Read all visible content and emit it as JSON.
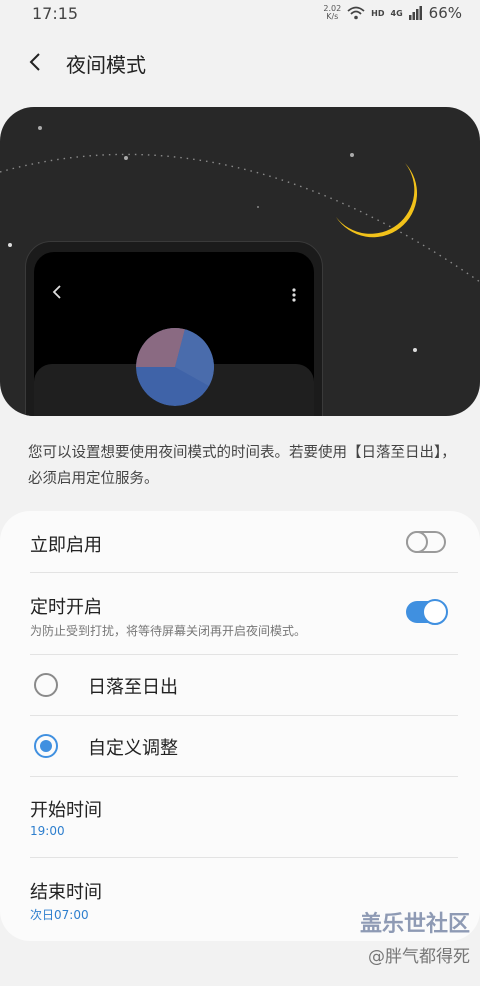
{
  "status": {
    "time": "17:15",
    "net_speed_top": "2.02",
    "net_speed_unit": "K/s",
    "hd": "HD",
    "network": "4G",
    "battery": "66%"
  },
  "header": {
    "title": "夜间模式"
  },
  "description": "您可以设置想要使用夜间模式的时间表。若要使用【日落至日出】，必须启用定位服务。",
  "settings": {
    "instant": {
      "label": "立即启用",
      "enabled": false
    },
    "scheduled": {
      "label": "定时开启",
      "sub": "为防止受到打扰，将等待屏幕关闭再开启夜间模式。",
      "enabled": true
    },
    "options": [
      {
        "label": "日落至日出",
        "selected": false
      },
      {
        "label": "自定义调整",
        "selected": true
      }
    ],
    "start": {
      "label": "开始时间",
      "value": "19:00"
    },
    "end": {
      "label": "结束时间",
      "value": "次日07:00"
    }
  },
  "watermark": {
    "line1": "盖乐世社区",
    "line2": "@胖气都得死"
  },
  "colors": {
    "accent": "#4090e0",
    "hero_bg": "#282828",
    "moon": "#f2c21a"
  }
}
